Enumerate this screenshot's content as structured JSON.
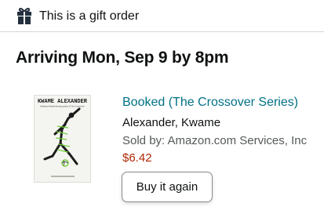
{
  "gift": {
    "icon": "gift-icon",
    "text": "This is a gift order"
  },
  "delivery": {
    "arrival": "Arriving Mon, Sep 9 by 8pm"
  },
  "item": {
    "cover": {
      "author_line": "KWAME ALEXANDER",
      "subtitle_line": "Newbery Medal-winning author of The Crossover"
    },
    "title": "Booked (The Crossover Series)",
    "author": "Alexander, Kwame",
    "seller": "Sold by: Amazon.com Services, Inc",
    "price": "$6.42"
  },
  "actions": {
    "buy_again": "Buy it again"
  },
  "colors": {
    "link": "#007185",
    "price": "#b12704",
    "muted": "#565959",
    "cover_accent": "#6fd03a"
  }
}
